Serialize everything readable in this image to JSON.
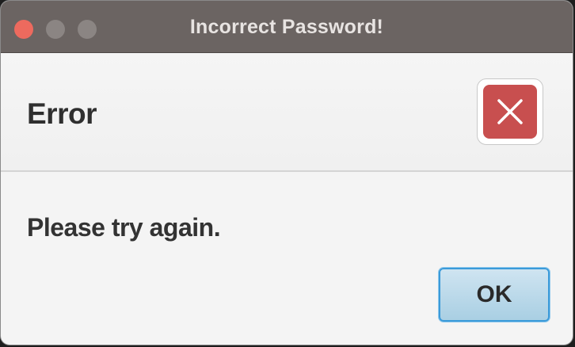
{
  "window": {
    "title": "Incorrect Password!",
    "traffic_lights": {
      "close_color": "#ed6a5e",
      "inactive_color": "#8b8583"
    }
  },
  "dialog": {
    "header_text": "Error",
    "icon": "error-x-icon",
    "icon_color": "#c84f4f",
    "message": "Please try again.",
    "ok_label": "OK",
    "accent_color": "#3a9ad9"
  }
}
